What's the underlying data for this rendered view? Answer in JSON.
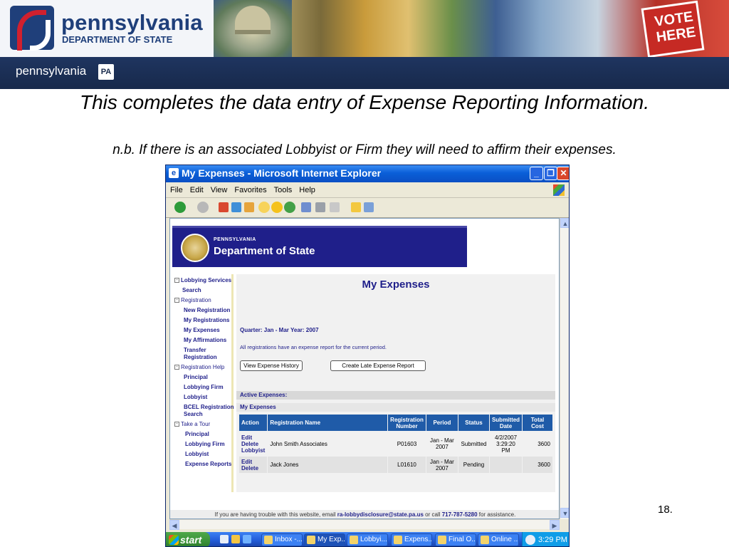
{
  "slide": {
    "header": {
      "logo_name": "pennsylvania",
      "logo_dept": "DEPARTMENT OF STATE",
      "vote_sign": "VOTE HERE",
      "subbar_text": "pennsylvania",
      "subbar_badge": "PA"
    },
    "title": "This completes the data entry of Expense Reporting Information.",
    "subtitle": "n.b.  If there is an associated Lobbyist or Firm they will need to affirm their expenses.",
    "page_number": "18."
  },
  "window": {
    "title": "My Expenses - Microsoft Internet Explorer",
    "menu": [
      "File",
      "Edit",
      "View",
      "Favorites",
      "Tools",
      "Help"
    ],
    "controls": {
      "minimize": "_",
      "maximize": "❐",
      "close": "✕"
    }
  },
  "page": {
    "header": {
      "small": "PENNSYLVANIA",
      "dept": "Department of State"
    },
    "nav": [
      {
        "label": "Lobbying Services",
        "type": "group"
      },
      {
        "label": "Search",
        "type": "link"
      },
      {
        "label": "Registration",
        "type": "group"
      },
      {
        "label": "New Registration",
        "type": "link"
      },
      {
        "label": "My Registrations",
        "type": "link"
      },
      {
        "label": "My Expenses",
        "type": "link"
      },
      {
        "label": "My Affirmations",
        "type": "link"
      },
      {
        "label": "Transfer",
        "type": "link"
      },
      {
        "label": "Registration",
        "type": "link"
      },
      {
        "label": "Registration Help",
        "type": "group"
      },
      {
        "label": "Principal",
        "type": "link"
      },
      {
        "label": "Lobbying Firm",
        "type": "link"
      },
      {
        "label": "Lobbyist",
        "type": "link"
      },
      {
        "label": "BCEL Registration",
        "type": "link"
      },
      {
        "label": "Search",
        "type": "link"
      },
      {
        "label": "Take a Tour",
        "type": "group"
      },
      {
        "label": "Principal",
        "type": "link"
      },
      {
        "label": "Lobbying Firm",
        "type": "link"
      },
      {
        "label": "Lobbyist",
        "type": "link"
      },
      {
        "label": "Expense Reports",
        "type": "link"
      }
    ],
    "heading": "My Expenses",
    "quarter_text": "Quarter:  Jan - Mar  Year:  2007",
    "note": "All registrations have an expense report for the current period.",
    "buttons": {
      "view_history": "View Expense History",
      "create_late": "Create Late Expense Report"
    },
    "active_expenses_label": "Active Expenses:",
    "my_expenses_label": "My Expenses",
    "table": {
      "headers": [
        "Action",
        "Registration Name",
        "Registration Number",
        "Period",
        "Status",
        "Submitted Date",
        "Total Cost"
      ],
      "rows": [
        {
          "actions": [
            "Edit",
            "Delete",
            "Lobbyist"
          ],
          "name": "John Smith Associates",
          "number": "P01603",
          "period": "Jan - Mar 2007",
          "status": "Submitted",
          "submitted": "4/2/2007 3:29:20 PM",
          "total": "3600"
        },
        {
          "actions": [
            "Edit",
            "Delete"
          ],
          "name": "Jack Jones",
          "number": "L01610",
          "period": "Jan - Mar 2007",
          "status": "Pending",
          "submitted": "",
          "total": "3600"
        }
      ]
    },
    "footer": {
      "prefix": "If you are having trouble with this website, email ",
      "email": "ra-lobbydisclosure@state.pa.us",
      "middle": " or call ",
      "phone": "717-787-5280",
      "suffix": " for assistance."
    }
  },
  "taskbar": {
    "start": "start",
    "items": [
      "Inbox -...",
      "My Exp...",
      "Lobbyi...",
      "Expens...",
      "Final O...",
      "Online ..."
    ],
    "time": "3:29 PM"
  }
}
